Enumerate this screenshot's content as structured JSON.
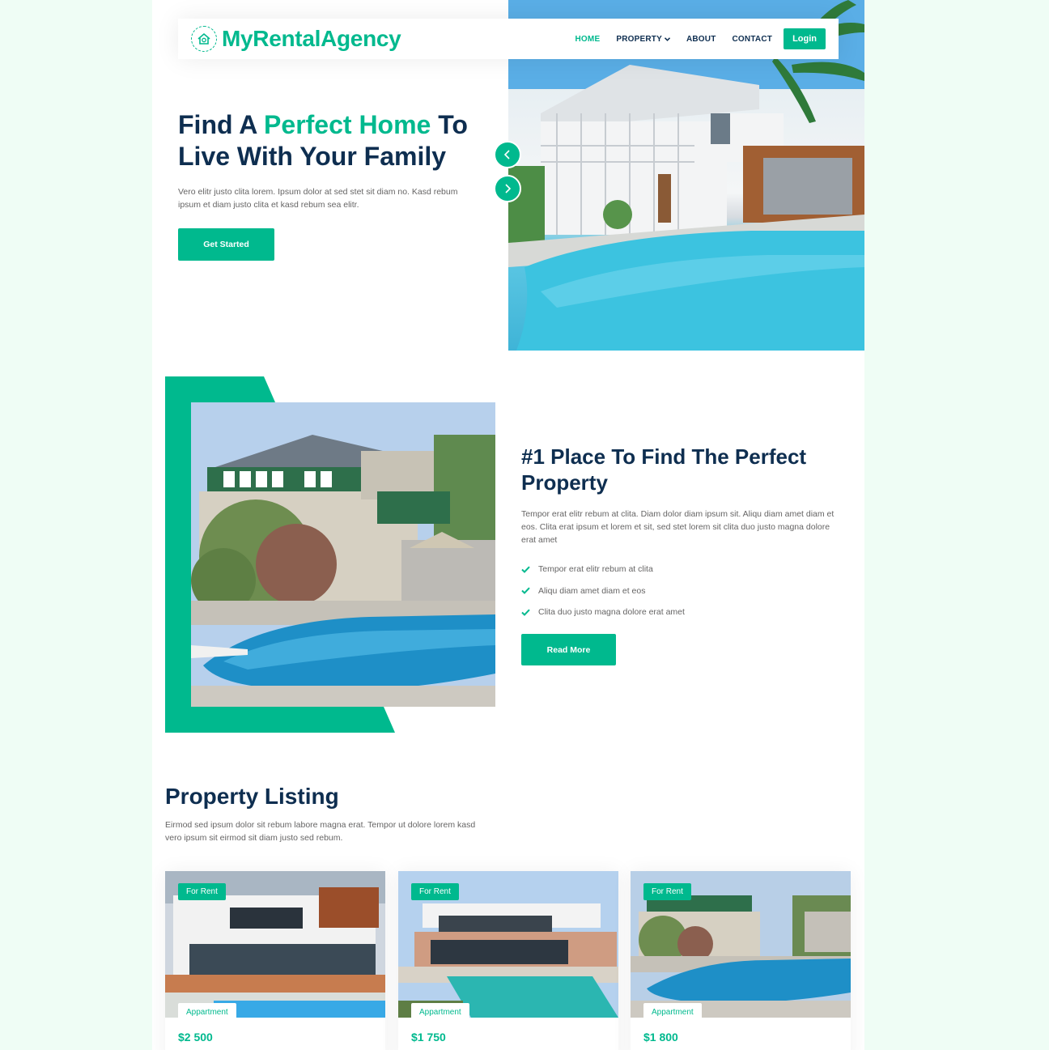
{
  "brand": {
    "name": "MyRentalAgency",
    "icon": "house-logo-icon"
  },
  "nav": {
    "items": [
      {
        "label": "HOME",
        "active": true
      },
      {
        "label": "PROPERTY",
        "dropdown": true
      },
      {
        "label": "ABOUT"
      },
      {
        "label": "CONTACT"
      }
    ],
    "login_label": "Login"
  },
  "hero": {
    "title_part1": "Find A ",
    "title_accent": "Perfect Home",
    "title_part2": " To Live With Your Family",
    "text": "Vero elitr justo clita lorem. Ipsum dolor at sed stet sit diam no. Kasd rebum ipsum et diam justo clita et kasd rebum sea elitr.",
    "cta_label": "Get Started"
  },
  "about": {
    "title": "#1 Place To Find The Perfect Property",
    "text": "Tempor erat elitr rebum at clita. Diam dolor diam ipsum sit. Aliqu diam amet diam et eos. Clita erat ipsum et lorem et sit, sed stet lorem sit clita duo justo magna dolore erat amet",
    "checks": [
      "Tempor erat elitr rebum at clita",
      "Aliqu diam amet diam et eos",
      "Clita duo justo magna dolore erat amet"
    ],
    "cta_label": "Read More"
  },
  "listing": {
    "title": "Property Listing",
    "text": "Eirmod sed ipsum dolor sit rebum labore magna erat. Tempor ut dolore lorem kasd vero ipsum sit eirmod sit diam justo sed rebum.",
    "cards": [
      {
        "status": "For Rent",
        "type": "Appartment",
        "price": "$2 500"
      },
      {
        "status": "For Rent",
        "type": "Appartment",
        "price": "$1 750"
      },
      {
        "status": "For Rent",
        "type": "Appartment",
        "price": "$1 800"
      }
    ]
  },
  "colors": {
    "primary": "#00b98e",
    "dark": "#0e2e50",
    "body_bg": "#effdf5"
  }
}
